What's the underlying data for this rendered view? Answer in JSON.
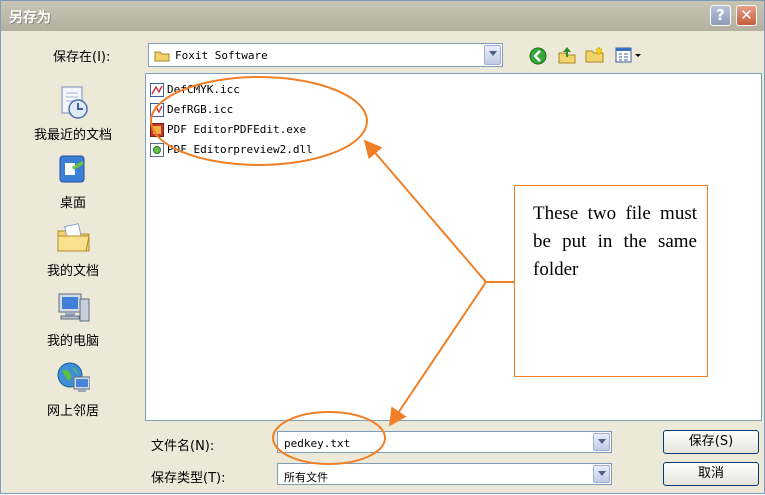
{
  "window": {
    "title": "另存为",
    "help_label": "?",
    "close_label": "✕"
  },
  "save_in": {
    "label": "保存在(I):",
    "value": "Foxit Software"
  },
  "places": [
    {
      "label": "我最近的文档",
      "icon": "recent-documents-icon"
    },
    {
      "label": "桌面",
      "icon": "desktop-icon"
    },
    {
      "label": "我的文档",
      "icon": "my-documents-icon"
    },
    {
      "label": "我的电脑",
      "icon": "my-computer-icon"
    },
    {
      "label": "网上邻居",
      "icon": "network-places-icon"
    }
  ],
  "files": [
    {
      "name": "DefCMYK.icc",
      "icon": "icc-file-icon"
    },
    {
      "name": "DefRGB.icc",
      "icon": "icc-file-icon"
    },
    {
      "name": "PDF EditorPDFEdit.exe",
      "icon": "exe-file-icon"
    },
    {
      "name": "PDF Editorpreview2.dll",
      "icon": "dll-file-icon"
    }
  ],
  "filename": {
    "label": "文件名(N):",
    "value": "pedkey.txt"
  },
  "filetype": {
    "label": "保存类型(T):",
    "value": "所有文件"
  },
  "buttons": {
    "save": "保存(S)",
    "cancel": "取消"
  },
  "annotation": {
    "text": "These two file must be put in the same folder",
    "color": "#f07f25"
  }
}
